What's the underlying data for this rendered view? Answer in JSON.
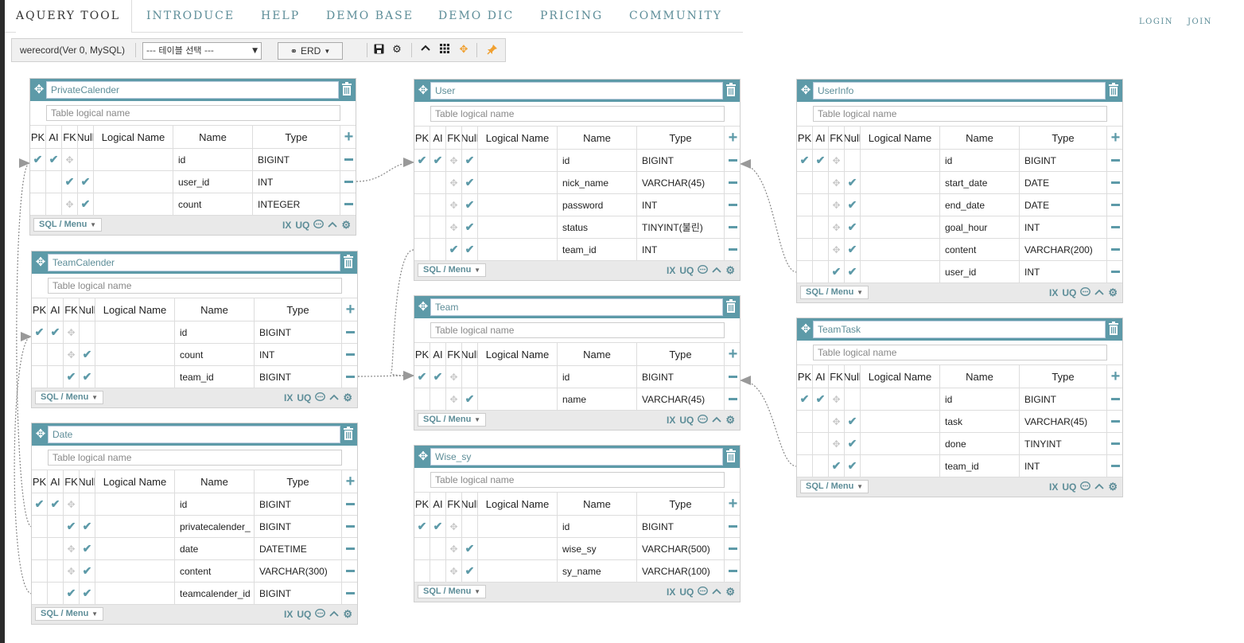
{
  "nav": {
    "brand": "AQUERY TOOL",
    "tabs": [
      "INTRODUCE",
      "HELP",
      "DEMO BASE",
      "DEMO DIC",
      "PRICING",
      "COMMUNITY"
    ],
    "login": "LOGIN",
    "join": "JOIN"
  },
  "toolbar": {
    "db_label": "werecord(Ver 0, MySQL)",
    "table_select_value": "--- 테이블 선택 ---",
    "erd_label": "ERD"
  },
  "common": {
    "logical_placeholder": "Table logical name",
    "headers": [
      "PK",
      "AI",
      "FK",
      "Null",
      "Logical Name",
      "Name",
      "Type"
    ],
    "sql_menu": "SQL / Menu",
    "ix": "IX",
    "uq": "UQ"
  },
  "tables": {
    "private_calender": {
      "name": "PrivateCalender",
      "rows": [
        {
          "pk": true,
          "ai": true,
          "fk": false,
          "null": false,
          "name": "id",
          "type": "BIGINT"
        },
        {
          "pk": false,
          "ai": false,
          "fk": true,
          "null": true,
          "name": "user_id",
          "type": "INT"
        },
        {
          "pk": false,
          "ai": false,
          "fk": false,
          "null": true,
          "name": "count",
          "type": "INTEGER"
        }
      ]
    },
    "team_calender": {
      "name": "TeamCalender",
      "rows": [
        {
          "pk": true,
          "ai": true,
          "fk": false,
          "null": false,
          "name": "id",
          "type": "BIGINT"
        },
        {
          "pk": false,
          "ai": false,
          "fk": false,
          "null": true,
          "name": "count",
          "type": "INT"
        },
        {
          "pk": false,
          "ai": false,
          "fk": true,
          "null": true,
          "name": "team_id",
          "type": "BIGINT"
        }
      ]
    },
    "date": {
      "name": "Date",
      "rows": [
        {
          "pk": true,
          "ai": true,
          "fk": false,
          "null": false,
          "name": "id",
          "type": "BIGINT"
        },
        {
          "pk": false,
          "ai": false,
          "fk": true,
          "null": true,
          "name": "privatecalender_",
          "type": "BIGINT"
        },
        {
          "pk": false,
          "ai": false,
          "fk": false,
          "null": true,
          "name": "date",
          "type": "DATETIME"
        },
        {
          "pk": false,
          "ai": false,
          "fk": false,
          "null": true,
          "name": "content",
          "type": "VARCHAR(300)"
        },
        {
          "pk": false,
          "ai": false,
          "fk": true,
          "null": true,
          "name": "teamcalender_id",
          "type": "BIGINT"
        }
      ]
    },
    "user": {
      "name": "User",
      "rows": [
        {
          "pk": true,
          "ai": true,
          "fk": false,
          "null": true,
          "name": "id",
          "type": "BIGINT"
        },
        {
          "pk": false,
          "ai": false,
          "fk": false,
          "null": true,
          "name": "nick_name",
          "type": "VARCHAR(45)"
        },
        {
          "pk": false,
          "ai": false,
          "fk": false,
          "null": true,
          "name": "password",
          "type": "INT"
        },
        {
          "pk": false,
          "ai": false,
          "fk": false,
          "null": true,
          "name": "status",
          "type": "TINYINT(불린)"
        },
        {
          "pk": false,
          "ai": false,
          "fk": true,
          "null": true,
          "name": "team_id",
          "type": "INT"
        }
      ]
    },
    "team": {
      "name": "Team",
      "rows": [
        {
          "pk": true,
          "ai": true,
          "fk": false,
          "null": false,
          "name": "id",
          "type": "BIGINT"
        },
        {
          "pk": false,
          "ai": false,
          "fk": false,
          "null": true,
          "name": "name",
          "type": "VARCHAR(45)"
        }
      ]
    },
    "wise_sy": {
      "name": "Wise_sy",
      "rows": [
        {
          "pk": true,
          "ai": true,
          "fk": false,
          "null": false,
          "name": "id",
          "type": "BIGINT"
        },
        {
          "pk": false,
          "ai": false,
          "fk": false,
          "null": true,
          "name": "wise_sy",
          "type": "VARCHAR(500)"
        },
        {
          "pk": false,
          "ai": false,
          "fk": false,
          "null": true,
          "name": "sy_name",
          "type": "VARCHAR(100)"
        }
      ]
    },
    "user_info": {
      "name": "UserInfo",
      "rows": [
        {
          "pk": true,
          "ai": true,
          "fk": false,
          "null": false,
          "name": "id",
          "type": "BIGINT"
        },
        {
          "pk": false,
          "ai": false,
          "fk": false,
          "null": true,
          "name": "start_date",
          "type": "DATE"
        },
        {
          "pk": false,
          "ai": false,
          "fk": false,
          "null": true,
          "name": "end_date",
          "type": "DATE"
        },
        {
          "pk": false,
          "ai": false,
          "fk": false,
          "null": true,
          "name": "goal_hour",
          "type": "INT"
        },
        {
          "pk": false,
          "ai": false,
          "fk": false,
          "null": true,
          "name": "content",
          "type": "VARCHAR(200)"
        },
        {
          "pk": false,
          "ai": false,
          "fk": true,
          "null": true,
          "name": "user_id",
          "type": "INT"
        }
      ]
    },
    "team_task": {
      "name": "TeamTask",
      "rows": [
        {
          "pk": true,
          "ai": true,
          "fk": false,
          "null": false,
          "name": "id",
          "type": "BIGINT"
        },
        {
          "pk": false,
          "ai": false,
          "fk": false,
          "null": true,
          "name": "task",
          "type": "VARCHAR(45)"
        },
        {
          "pk": false,
          "ai": false,
          "fk": false,
          "null": true,
          "name": "done",
          "type": "TINYINT"
        },
        {
          "pk": false,
          "ai": false,
          "fk": true,
          "null": true,
          "name": "team_id",
          "type": "INT"
        }
      ]
    }
  },
  "colors": {
    "accent": "#5d9aa8",
    "nav_text": "#5d8d98",
    "relation_line": "#888888"
  }
}
